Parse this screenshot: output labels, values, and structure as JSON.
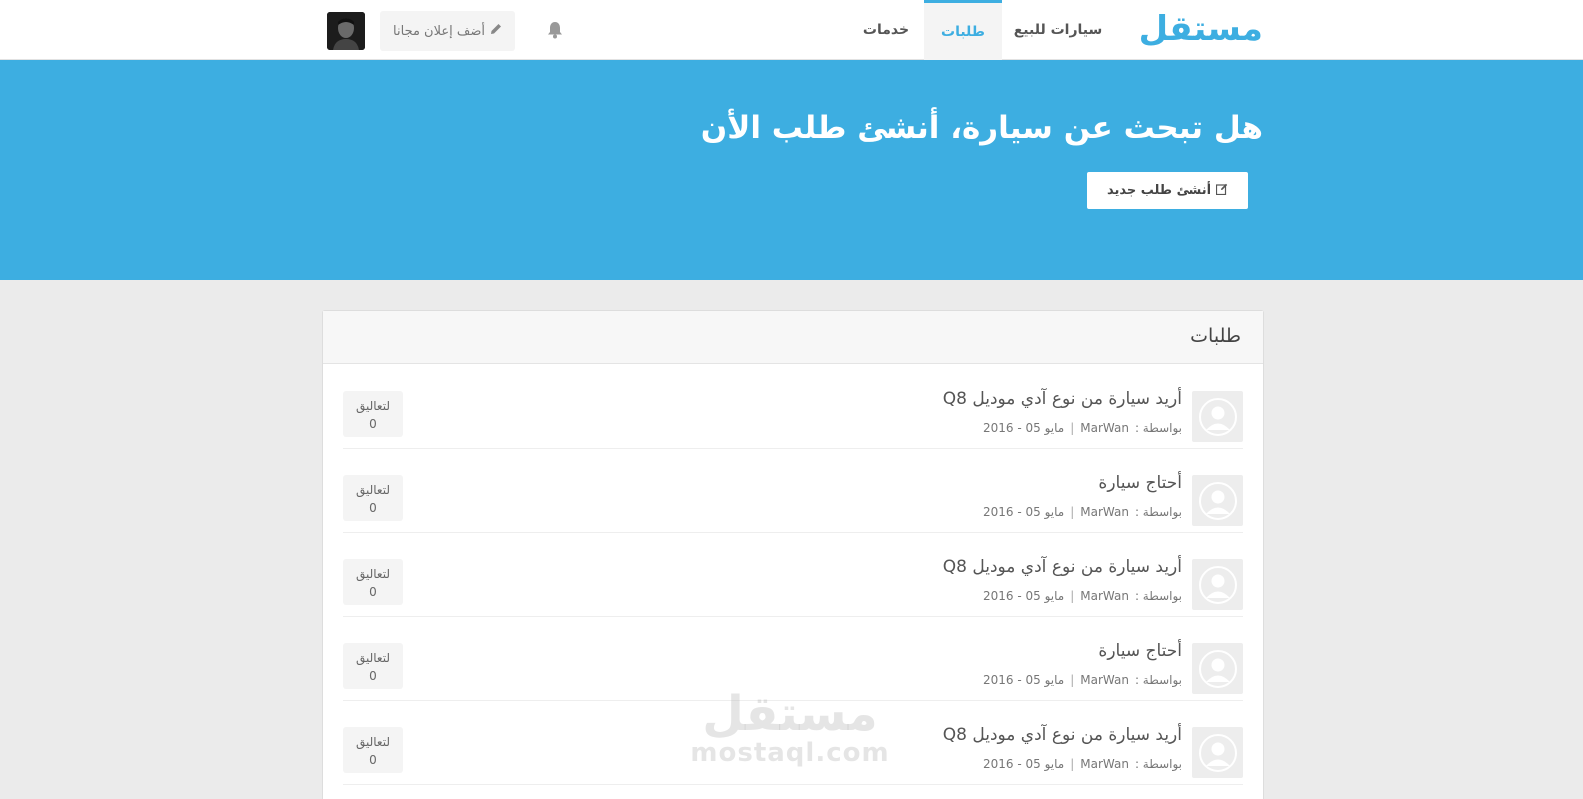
{
  "header": {
    "logo": "مستقل",
    "nav": [
      {
        "label": "سيارات للبيع"
      },
      {
        "label": "طلبات"
      },
      {
        "label": "خدمات"
      }
    ],
    "add_ad_label": "أضف إعلان مجانا",
    "bell_icon": "bell-icon",
    "accent": "#3daee1"
  },
  "hero": {
    "title": "هل تبحث عن سيارة، أنشئ طلب الأن",
    "button_label": "أنشئ طلب جديد",
    "button_icon": "edit-icon"
  },
  "panel": {
    "title": "طلبات",
    "rows": [
      {
        "title": "أريد سيارة من نوع آدي موديل Q8",
        "by_label": "بواسطة :",
        "author": "MarWan",
        "date": "مايو 05 - 2016",
        "comments_label": "لتعاليق",
        "comments_count": "0"
      },
      {
        "title": "أحتاج سيارة",
        "by_label": "بواسطة :",
        "author": "MarWan",
        "date": "مايو 05 - 2016",
        "comments_label": "لتعاليق",
        "comments_count": "0"
      },
      {
        "title": "أريد سيارة من نوع آدي موديل Q8",
        "by_label": "بواسطة :",
        "author": "MarWan",
        "date": "مايو 05 - 2016",
        "comments_label": "لتعاليق",
        "comments_count": "0"
      },
      {
        "title": "أحتاج سيارة",
        "by_label": "بواسطة :",
        "author": "MarWan",
        "date": "مايو 05 - 2016",
        "comments_label": "لتعاليق",
        "comments_count": "0"
      },
      {
        "title": "أريد سيارة من نوع آدي موديل Q8",
        "by_label": "بواسطة :",
        "author": "MarWan",
        "date": "مايو 05 - 2016",
        "comments_label": "لتعاليق",
        "comments_count": "0"
      }
    ]
  },
  "watermark": {
    "arabic": "مستقل",
    "latin": "mostaql.com"
  }
}
